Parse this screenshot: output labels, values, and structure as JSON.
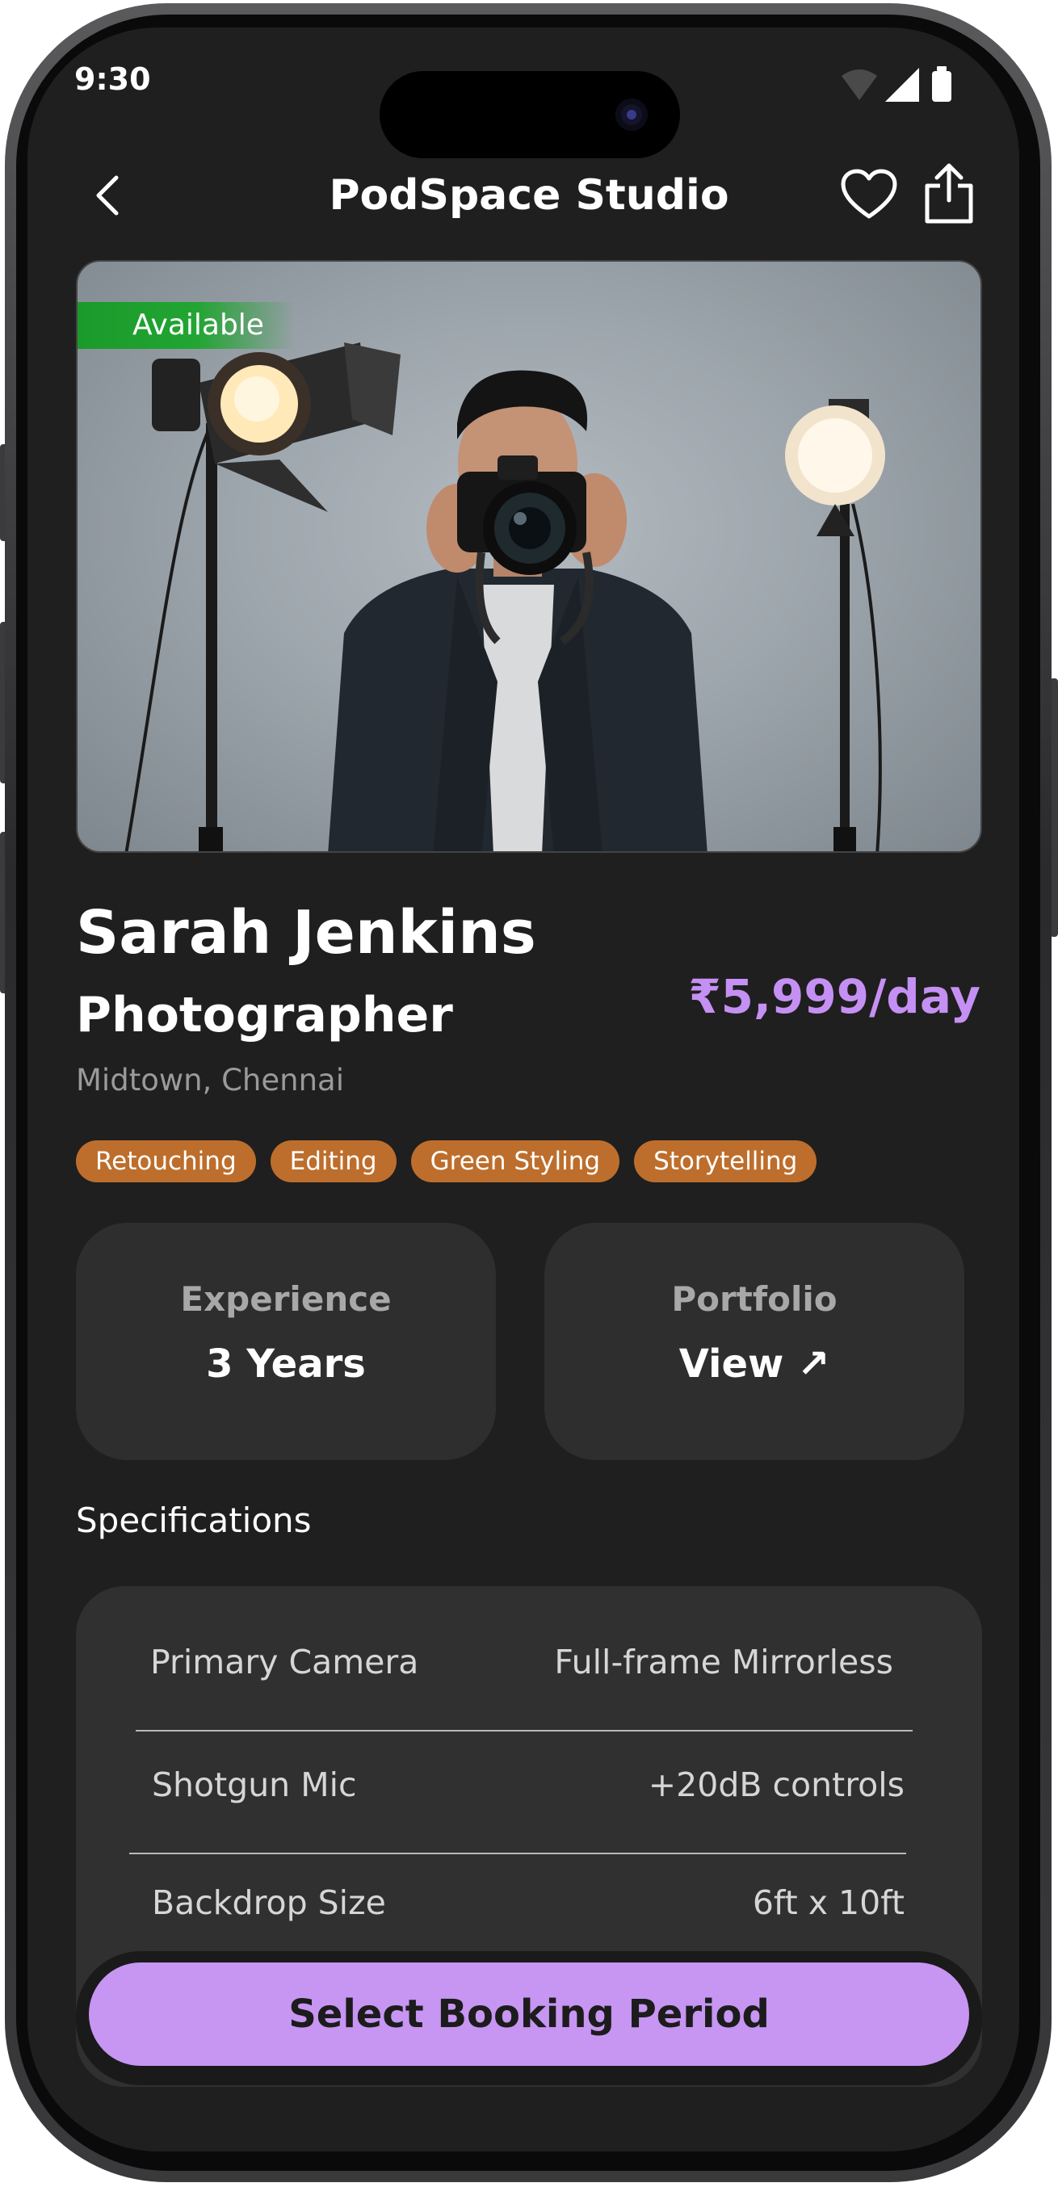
{
  "status_bar": {
    "time": "9:30"
  },
  "header": {
    "title": "PodSpace Studio"
  },
  "hero": {
    "badge": "Available"
  },
  "profile": {
    "name": "Sarah Jenkins",
    "role": "Photographer",
    "price": "₹5,999/day",
    "location": "Midtown, Chennai",
    "tags": [
      "Retouching",
      "Editing",
      "Green Styling",
      "Storytelling"
    ]
  },
  "stats": {
    "experience": {
      "label": "Experience",
      "value": "3 Years"
    },
    "portfolio": {
      "label": "Portfolio",
      "value": "View ↗"
    }
  },
  "specifications": {
    "heading": "Specifications",
    "rows": [
      {
        "key": "Primary Camera",
        "value": "Full-frame Mirrorless"
      },
      {
        "key": "Shotgun Mic",
        "value": "+20dB controls"
      },
      {
        "key": "Backdrop Size",
        "value": "6ft x 10ft"
      }
    ]
  },
  "cta": {
    "label": "Select Booking Period"
  },
  "colors": {
    "accent": "#c795f2",
    "price": "#c590f3",
    "tag": "#bd6e2c",
    "available": "#22a533",
    "background": "#1f1f1f"
  },
  "icons": [
    "back-chevron-icon",
    "heart-icon",
    "share-icon",
    "wifi-icon",
    "cellular-icon",
    "battery-icon"
  ]
}
